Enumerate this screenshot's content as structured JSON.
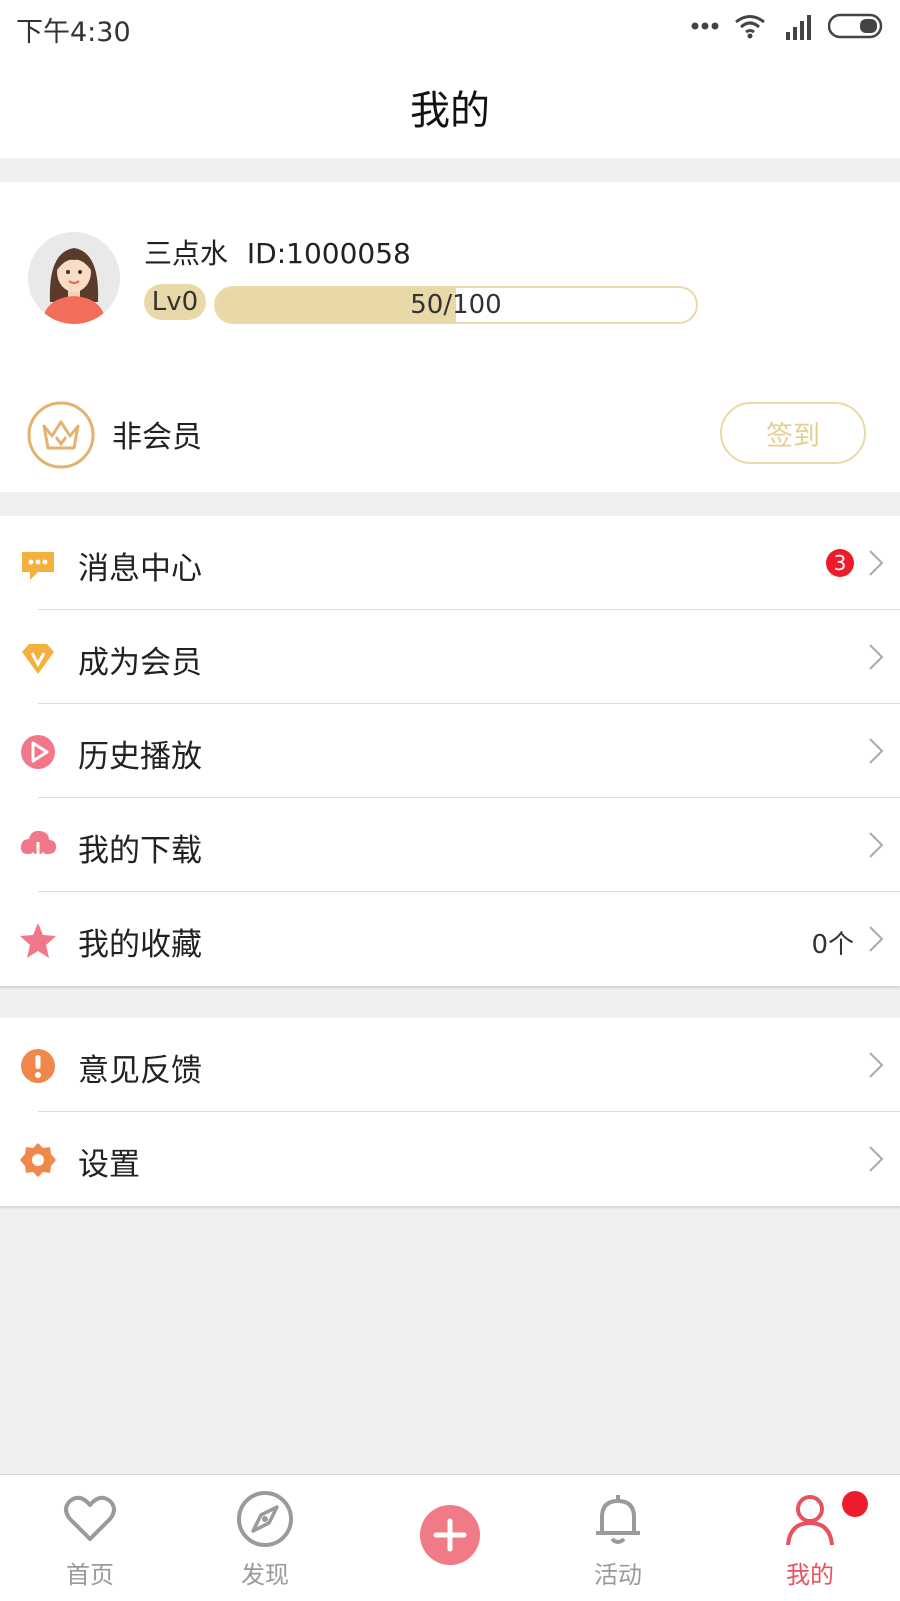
{
  "status_bar": {
    "time": "下午4:30"
  },
  "header": {
    "title": "我的"
  },
  "profile": {
    "username": "三点水",
    "user_id_text": "ID:1000058",
    "level": "Lv0",
    "progress_text": "50/100",
    "progress_fraction": 0.5,
    "membership_status": "非会员",
    "sign_in_label": "签到"
  },
  "menu_primary": [
    {
      "label": "消息中心",
      "badge": "3"
    },
    {
      "label": "成为会员"
    },
    {
      "label": "历史播放"
    },
    {
      "label": "我的下载"
    },
    {
      "label": "我的收藏",
      "count": "0个"
    }
  ],
  "menu_secondary": [
    {
      "label": "意见反馈"
    },
    {
      "label": "设置"
    }
  ],
  "tabbar": {
    "tabs": [
      {
        "label": "首页",
        "icon": "heart-icon"
      },
      {
        "label": "发现",
        "icon": "compass-icon"
      },
      {
        "label": "",
        "icon": "add-icon"
      },
      {
        "label": "活动",
        "icon": "bell-icon"
      },
      {
        "label": "我的",
        "icon": "person-icon",
        "active": true
      }
    ]
  },
  "colors": {
    "accent": "#e8525f",
    "gold": "#ead9a8",
    "badge_red": "#f01b2a"
  }
}
